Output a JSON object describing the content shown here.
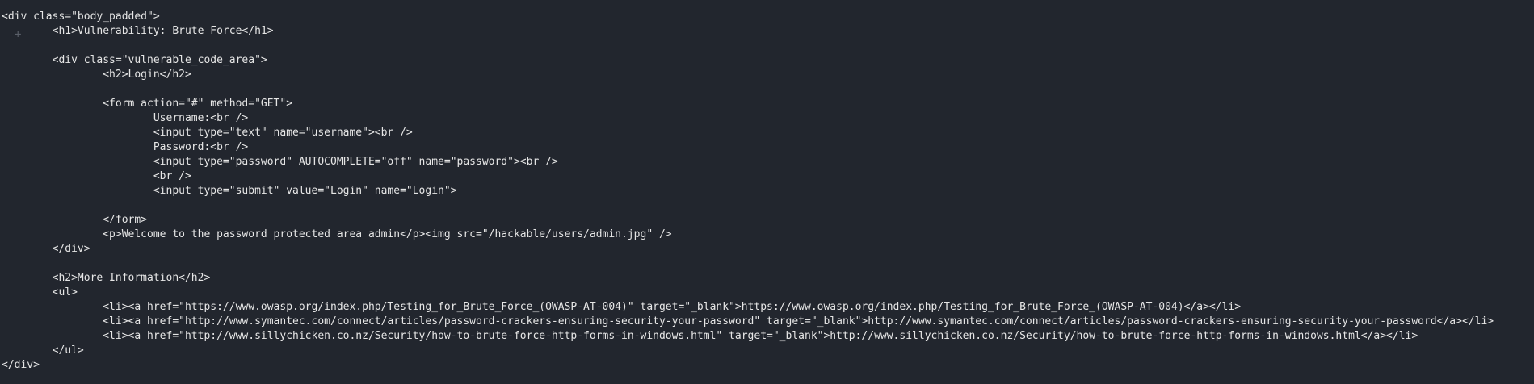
{
  "source_lines": [
    "<div class=\"body_padded\">",
    "        <h1>Vulnerability: Brute Force</h1>",
    "",
    "        <div class=\"vulnerable_code_area\">",
    "                <h2>Login</h2>",
    "",
    "                <form action=\"#\" method=\"GET\">",
    "                        Username:<br />",
    "                        <input type=\"text\" name=\"username\"><br />",
    "                        Password:<br />",
    "                        <input type=\"password\" AUTOCOMPLETE=\"off\" name=\"password\"><br />",
    "                        <br />",
    "                        <input type=\"submit\" value=\"Login\" name=\"Login\">",
    "",
    "                </form>",
    "                <p>Welcome to the password protected area admin</p><img src=\"/hackable/users/admin.jpg\" />",
    "        </div>",
    "",
    "        <h2>More Information</h2>",
    "        <ul>",
    "                <li><a href=\"https://www.owasp.org/index.php/Testing_for_Brute_Force_(OWASP-AT-004)\" target=\"_blank\">https://www.owasp.org/index.php/Testing_for_Brute_Force_(OWASP-AT-004)</a></li>",
    "                <li><a href=\"http://www.symantec.com/connect/articles/password-crackers-ensuring-security-your-password\" target=\"_blank\">http://www.symantec.com/connect/articles/password-crackers-ensuring-security-your-password</a></li>",
    "                <li><a href=\"http://www.sillychicken.co.nz/Security/how-to-brute-force-http-forms-in-windows.html\" target=\"_blank\">http://www.sillychicken.co.nz/Security/how-to-brute-force-http-forms-in-windows.html</a></li>",
    "        </ul>",
    "</div>"
  ],
  "ghost_icon": "plus-icon"
}
